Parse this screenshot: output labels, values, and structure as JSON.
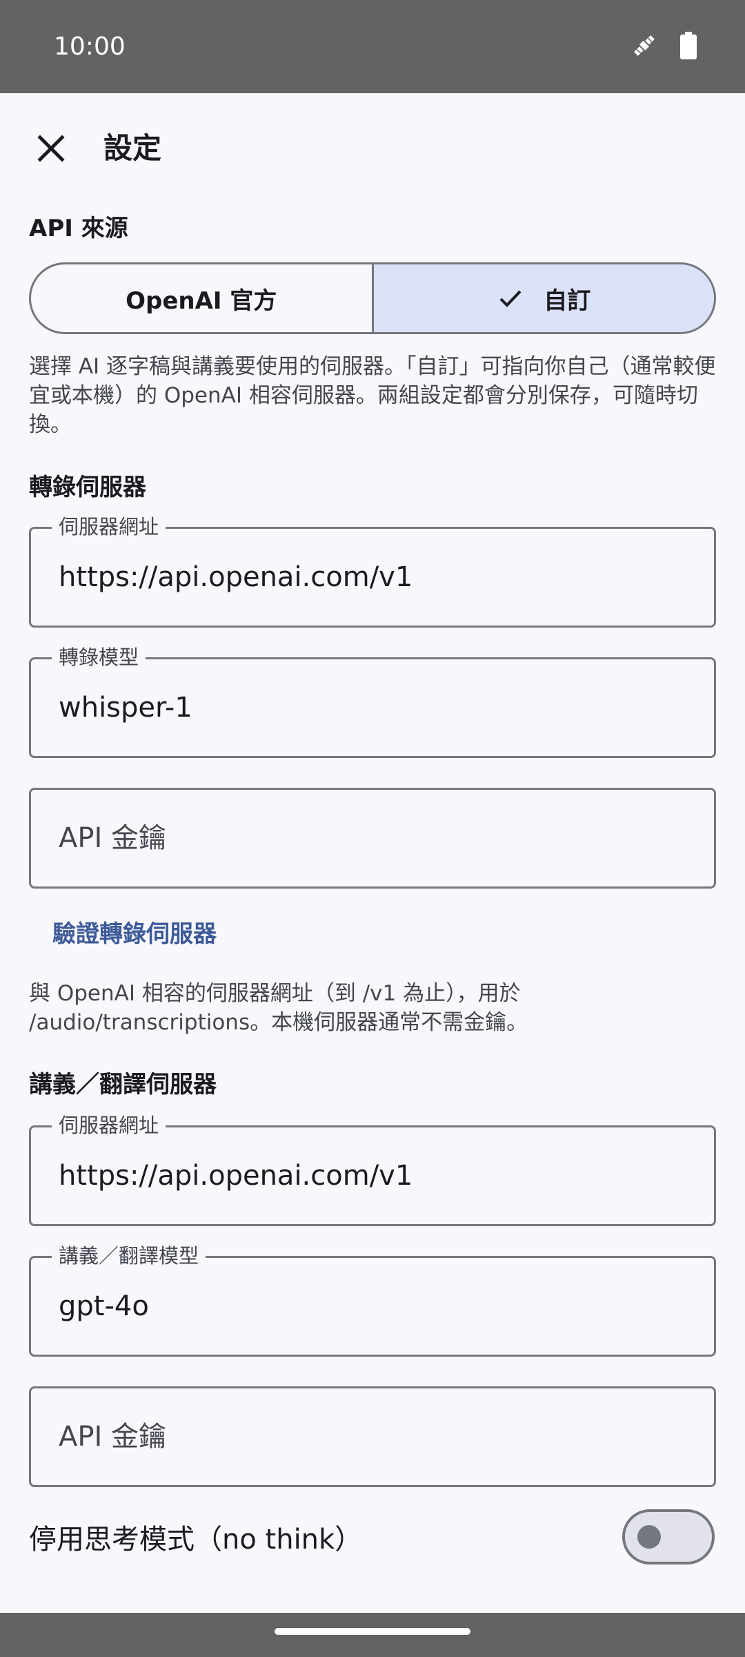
{
  "status_bar": {
    "time": "10:00",
    "icons": [
      "satellite-icon",
      "battery-icon"
    ]
  },
  "header": {
    "close_icon": "close-icon",
    "title": "設定"
  },
  "api_source": {
    "label": "API 來源",
    "options": [
      {
        "label": "OpenAI 官方",
        "selected": false
      },
      {
        "label": "自訂",
        "selected": true,
        "icon": "check-icon"
      }
    ],
    "help": "選擇 AI 逐字稿與講義要使用的伺服器。「自訂」可指向你自己（通常較便宜或本機）的 OpenAI 相容伺服器。兩組設定都會分別保存，可隨時切換。"
  },
  "transcription": {
    "label": "轉錄伺服器",
    "server_url": {
      "label": "伺服器網址",
      "value": "https://api.openai.com/v1"
    },
    "model": {
      "label": "轉錄模型",
      "value": "whisper-1"
    },
    "api_key": {
      "placeholder": "API 金鑰",
      "value": ""
    },
    "verify_button": "驗證轉錄伺服器",
    "help": "與 OpenAI 相容的伺服器網址（到 /v1 為止），用於 /audio/transcriptions。本機伺服器通常不需金鑰。"
  },
  "notes": {
    "label": "講義／翻譯伺服器",
    "server_url": {
      "label": "伺服器網址",
      "value": "https://api.openai.com/v1"
    },
    "model": {
      "label": "講義／翻譯模型",
      "value": "gpt-4o"
    },
    "api_key": {
      "placeholder": "API 金鑰",
      "value": ""
    }
  },
  "no_think": {
    "label": "停用思考模式（no think）",
    "enabled": false
  },
  "colors": {
    "accent": "#3d5a98",
    "selected_segment": "#dbe1f8",
    "outline": "#75777f",
    "system_bars": "#636363"
  }
}
